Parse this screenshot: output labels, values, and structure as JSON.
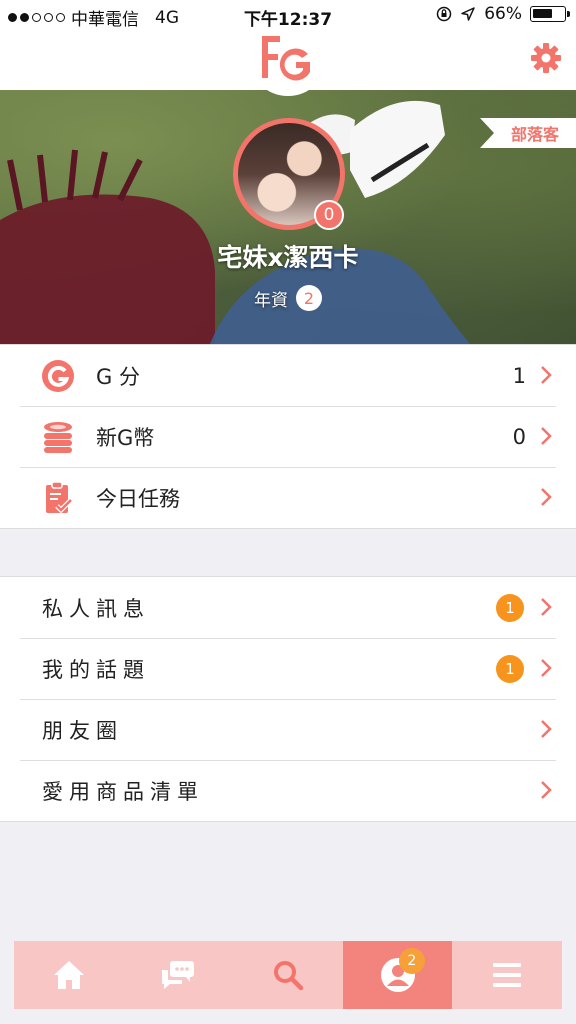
{
  "status_bar": {
    "carrier": "中華電信",
    "network": "4G",
    "time": "下午12:37",
    "battery": "66%",
    "battery_level": 0.66
  },
  "header": {
    "logo_text": "FG",
    "settings_icon": "gear-icon"
  },
  "profile": {
    "blog_tag": "部落客",
    "avatar_badge": "0",
    "username": "宅妹x潔西卡",
    "seniority_label": "年資",
    "seniority_value": "2"
  },
  "account_list": [
    {
      "icon": "g-points-icon",
      "label": "G 分",
      "value": "1"
    },
    {
      "icon": "coins-icon",
      "label": "新G幣",
      "value": "0"
    },
    {
      "icon": "clipboard-task-icon",
      "label": "今日任務",
      "value": ""
    }
  ],
  "social_list": [
    {
      "label": "私人訊息",
      "badge": "1"
    },
    {
      "label": "我的話題",
      "badge": "1"
    },
    {
      "label": "朋友圈",
      "badge": ""
    },
    {
      "label": "愛用商品清單",
      "badge": ""
    }
  ],
  "tab_bar": {
    "tabs": [
      {
        "icon": "home-icon"
      },
      {
        "icon": "chat-icon"
      },
      {
        "icon": "search-icon"
      },
      {
        "icon": "profile-icon",
        "badge": "2",
        "active": true
      },
      {
        "icon": "menu-icon"
      }
    ]
  },
  "colors": {
    "accent": "#f2746b",
    "badge_orange": "#f7941e",
    "tab_bar_bg": "#f9c6c6",
    "tab_active_bg": "#f2847d"
  }
}
